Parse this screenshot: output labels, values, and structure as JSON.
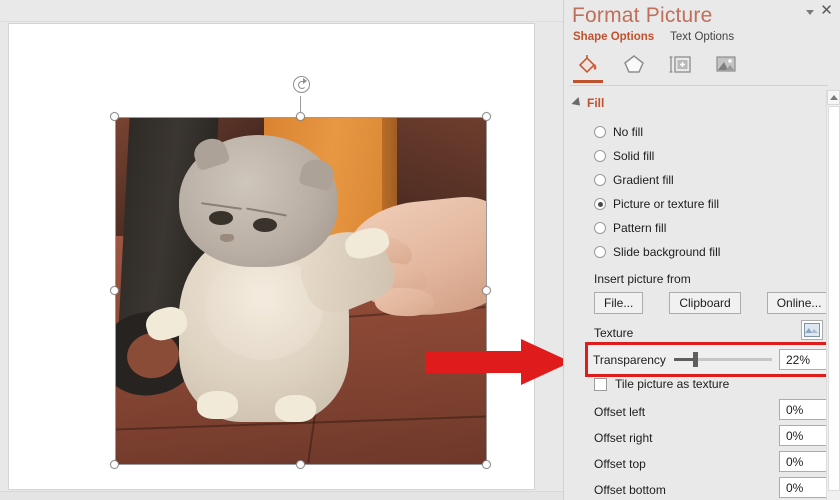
{
  "panel": {
    "title": "Format Picture",
    "dropdown_icon": "chevron-down-icon",
    "close_icon": "close-icon",
    "option_tabs": [
      {
        "label": "Shape Options",
        "active": true
      },
      {
        "label": "Text Options",
        "active": false
      }
    ],
    "category_icons": [
      {
        "name": "fill-bucket-icon",
        "active": true
      },
      {
        "name": "effects-pentagon-icon",
        "active": false
      },
      {
        "name": "size-layout-icon",
        "active": false
      },
      {
        "name": "picture-icon",
        "active": false
      }
    ],
    "accent_color": "#c0522e",
    "title_color": "#c0705a",
    "highlight_color": "#e01b1b"
  },
  "fill_section": {
    "header": "Fill",
    "expanded": true,
    "options": [
      {
        "label": "No fill",
        "accel": "N",
        "selected": false
      },
      {
        "label": "Solid fill",
        "accel": "S",
        "selected": false
      },
      {
        "label": "Gradient fill",
        "accel": "G",
        "selected": false
      },
      {
        "label": "Picture or texture fill",
        "accel": "P",
        "selected": true
      },
      {
        "label": "Pattern fill",
        "accel": "a",
        "selected": false
      },
      {
        "label": "Slide background fill",
        "accel": "b",
        "selected": false
      }
    ],
    "insert_picture_from_label": "Insert picture from",
    "insert_buttons": [
      {
        "label": "File...",
        "accel": "F"
      },
      {
        "label": "Clipboard",
        "accel": "C"
      },
      {
        "label": "Online...",
        "accel": "g"
      }
    ],
    "texture_label": "Texture",
    "texture_swatch_icon": "texture-swatch-icon",
    "transparency": {
      "label": "Transparency",
      "accel": "T",
      "value": "22%",
      "slider_percent": 22,
      "highlighted": true
    },
    "tile_checkbox": {
      "label": "Tile picture as texture",
      "accel": "l",
      "checked": false
    },
    "offsets": [
      {
        "label": "Offset left",
        "accel": "l",
        "value": "0%"
      },
      {
        "label": "Offset right",
        "accel": "r",
        "value": "0%"
      },
      {
        "label": "Offset top",
        "accel": "o",
        "value": "0%"
      },
      {
        "label": "Offset bottom",
        "accel": "m",
        "value": "0%"
      }
    ]
  },
  "slide": {
    "selected_picture": {
      "name": "cat-photo",
      "description": "Scottish Fold cat being held by a hand on a terracotta tile floor",
      "selected": true,
      "rotation_handle": "rotate-handle-icon",
      "handle_count": 8
    }
  },
  "annotation": {
    "red_arrow": "red-arrow-pointer",
    "points_to": "Transparency"
  }
}
